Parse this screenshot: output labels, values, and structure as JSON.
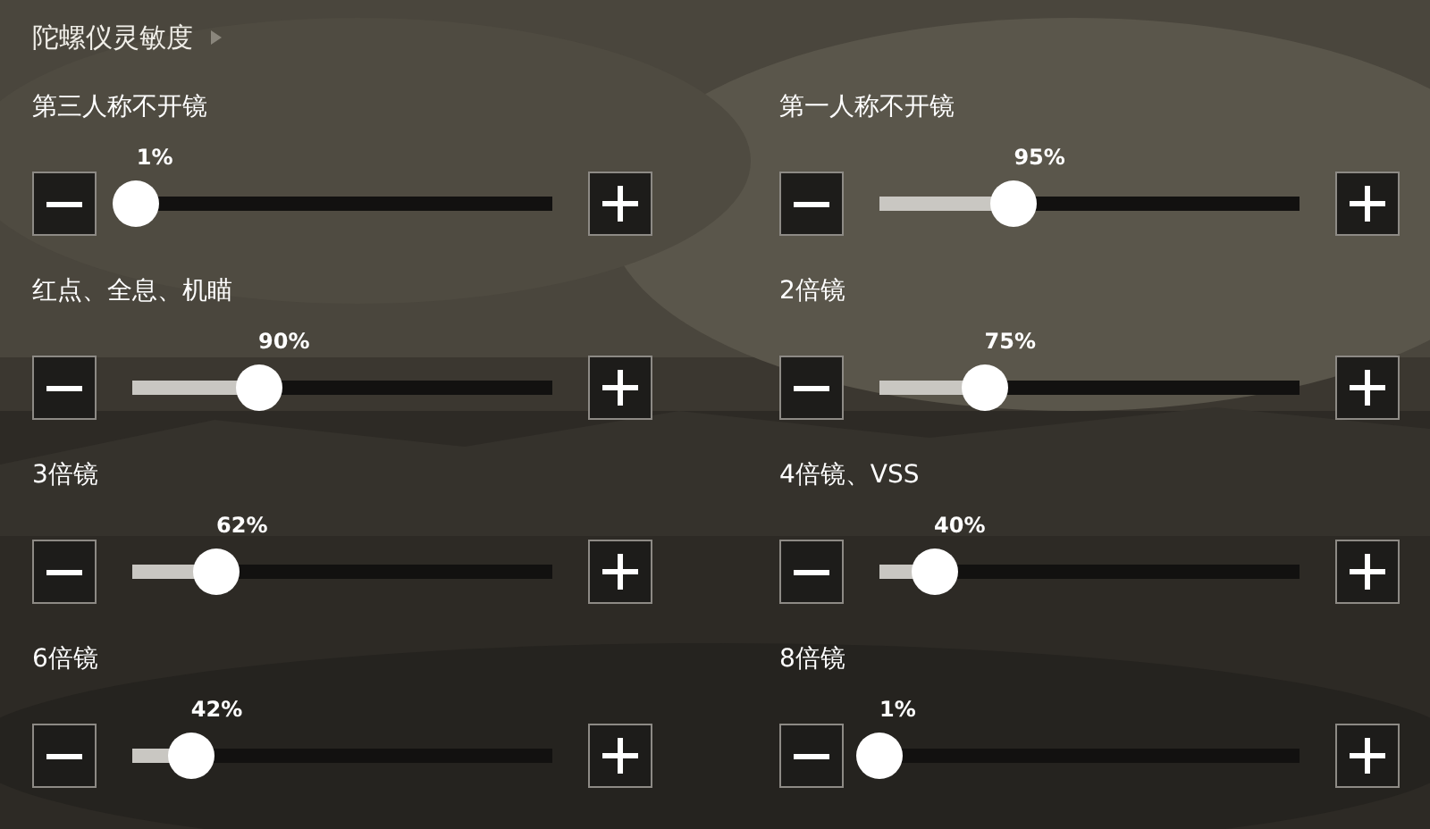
{
  "title": "陀螺仪灵敏度",
  "settings": [
    {
      "label": "第三人称不开镜",
      "reading": "1%",
      "level": 0.01
    },
    {
      "label": "第一人称不开镜",
      "reading": "95%",
      "level": 0.32
    },
    {
      "label": "红点、全息、机瞄",
      "reading": "90%",
      "level": 0.3
    },
    {
      "label": "2倍镜",
      "reading": "75%",
      "level": 0.25
    },
    {
      "label": "3倍镜",
      "reading": "62%",
      "level": 0.2
    },
    {
      "label": "4倍镜、VSS",
      "reading": "40%",
      "level": 0.13
    },
    {
      "label": "6倍镜",
      "reading": "42%",
      "level": 0.14
    },
    {
      "label": "8倍镜",
      "reading": "1%",
      "level": 0.0
    }
  ]
}
